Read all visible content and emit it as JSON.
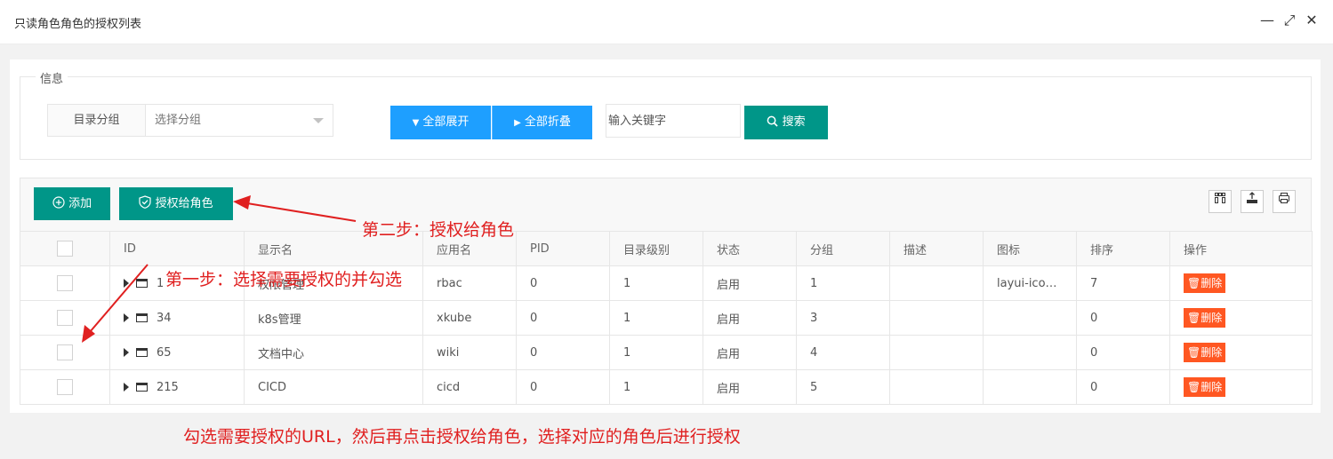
{
  "window": {
    "title": "只读角色角色的授权列表",
    "minimize_icon": "—",
    "maximize_icon": "⤢",
    "close_icon": "✕"
  },
  "filter": {
    "legend": "信息",
    "group_label": "目录分组",
    "group_select_value": "选择分组",
    "expand_all": "全部展开",
    "collapse_all": "全部折叠",
    "keyword_placeholder": "输入关键字",
    "search": "搜索"
  },
  "toolbar": {
    "add": "添加",
    "grant": "授权给角色"
  },
  "table": {
    "headers": [
      "ID",
      "显示名",
      "应用名",
      "PID",
      "目录级别",
      "状态",
      "分组",
      "描述",
      "图标",
      "排序",
      "操作"
    ],
    "rows": [
      {
        "id": "1",
        "display_name": "权限管理",
        "app": "rbac",
        "pid": "0",
        "level": "1",
        "status": "启用",
        "group": "1",
        "desc": "",
        "icon": "layui-icon-...",
        "sort": "7",
        "action": "删除"
      },
      {
        "id": "34",
        "display_name": "k8s管理",
        "app": "xkube",
        "pid": "0",
        "level": "1",
        "status": "启用",
        "group": "3",
        "desc": "",
        "icon": "",
        "sort": "0",
        "action": "删除"
      },
      {
        "id": "65",
        "display_name": "文档中心",
        "app": "wiki",
        "pid": "0",
        "level": "1",
        "status": "启用",
        "group": "4",
        "desc": "",
        "icon": "",
        "sort": "0",
        "action": "删除"
      },
      {
        "id": "215",
        "display_name": "CICD",
        "app": "cicd",
        "pid": "0",
        "level": "1",
        "status": "启用",
        "group": "5",
        "desc": "",
        "icon": "",
        "sort": "0",
        "action": "删除"
      }
    ]
  },
  "annotations": {
    "step1": "第一步：选择需要授权的并勾选",
    "step2": "第二步：授权给角色",
    "bottom": "勾选需要授权的URL，然后再点击授权给角色，选择对应的角色后进行授权"
  },
  "colors": {
    "primary": "#009688",
    "blue": "#1e9fff",
    "danger": "#ff5722",
    "annotation": "#e02020"
  }
}
